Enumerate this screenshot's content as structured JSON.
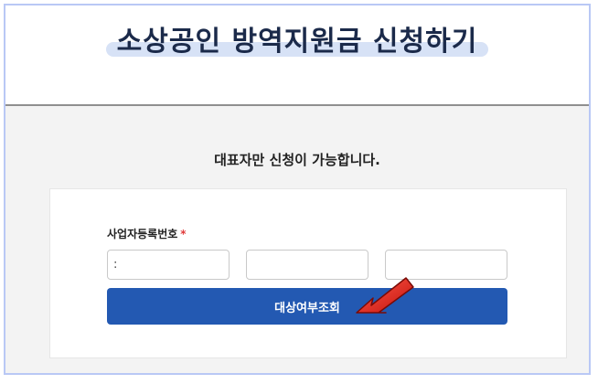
{
  "header": {
    "title": "소상공인 방역지원금 신청하기"
  },
  "main": {
    "notice": "대표자만 신청이 가능합니다."
  },
  "form": {
    "business_number_label": "사업자등록번호",
    "required_mark": "*",
    "part1_value": ":",
    "part2_value": "",
    "part3_value": "",
    "submit_label": "대상여부조회"
  },
  "colors": {
    "accent": "#2359b2",
    "required": "#e03a3a",
    "arrow": "#e8241c"
  },
  "icons": {
    "pointer": "red-arrow-icon"
  }
}
